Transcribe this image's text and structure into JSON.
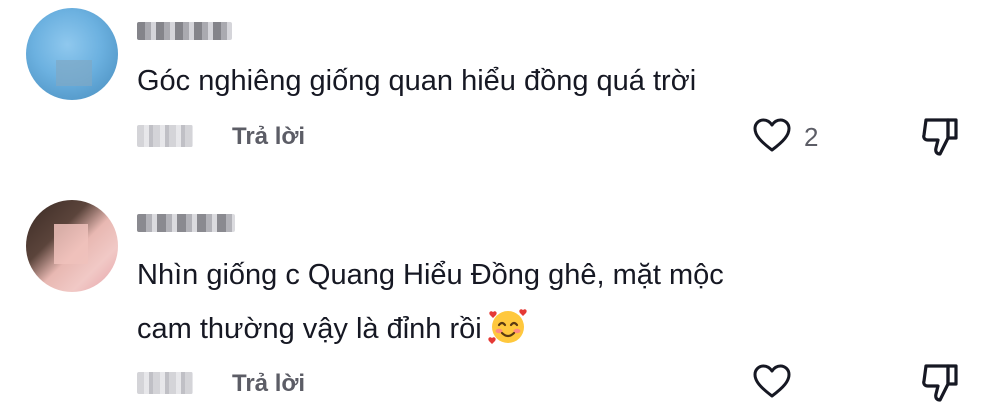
{
  "comments": [
    {
      "text": "Góc nghiêng giống quan hiểu đồng quá trời",
      "reply_label": "Trả lời",
      "like_count": "2",
      "avatar_icon": "blurred-avatar-blue",
      "like_icon": "heart-outline-icon",
      "dislike_icon": "thumbs-down-icon"
    },
    {
      "text_line1": "Nhìn giống c Quang Hiểu Đồng ghê, mặt mộc",
      "text_line2": "cam thường vậy là đỉnh rồi",
      "reply_label": "Trả lời",
      "avatar_icon": "blurred-avatar-portrait",
      "emoji_icon": "smiling-face-with-hearts-emoji",
      "like_icon": "heart-outline-icon",
      "dislike_icon": "thumbs-down-icon"
    }
  ],
  "colors": {
    "text": "#161823",
    "muted": "#5c5d66",
    "background": "#ffffff"
  }
}
